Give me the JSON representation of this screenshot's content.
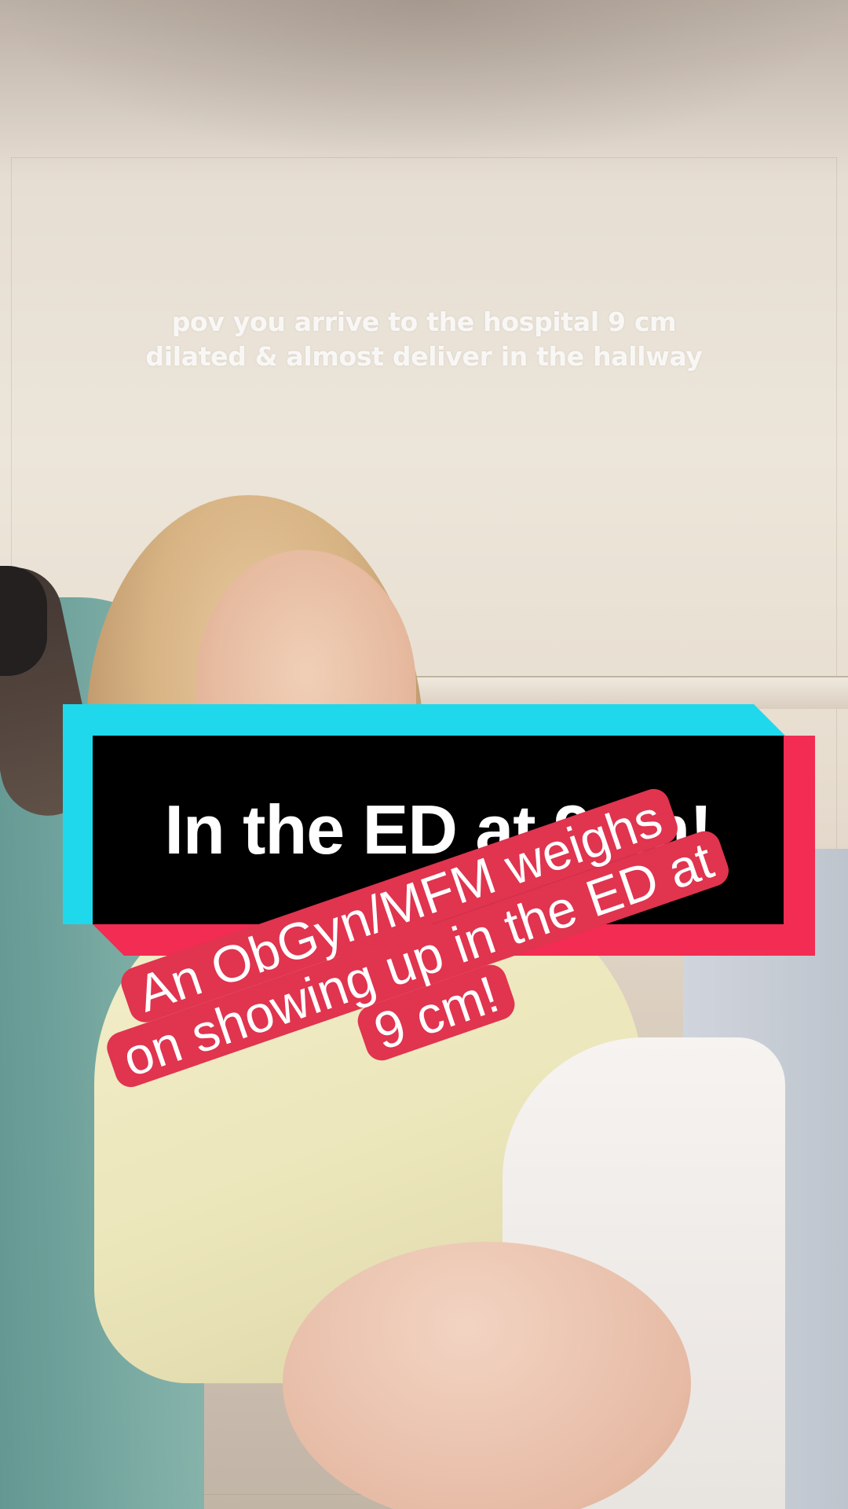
{
  "video": {
    "pov_caption_lines": [
      "pov you arrive to the hospital 9 cm",
      "dilated & almost deliver in the hallway"
    ],
    "title_banner": "In the ED at 9cm!",
    "sticker_lines": [
      "An ObGyn/MFM weighs",
      "on showing up in the ED at",
      "9 cm!"
    ]
  },
  "colors": {
    "banner_cyan": "#20d8ec",
    "banner_red": "#f22c52",
    "banner_black": "#000000",
    "sticker_red": "#e0344f"
  }
}
